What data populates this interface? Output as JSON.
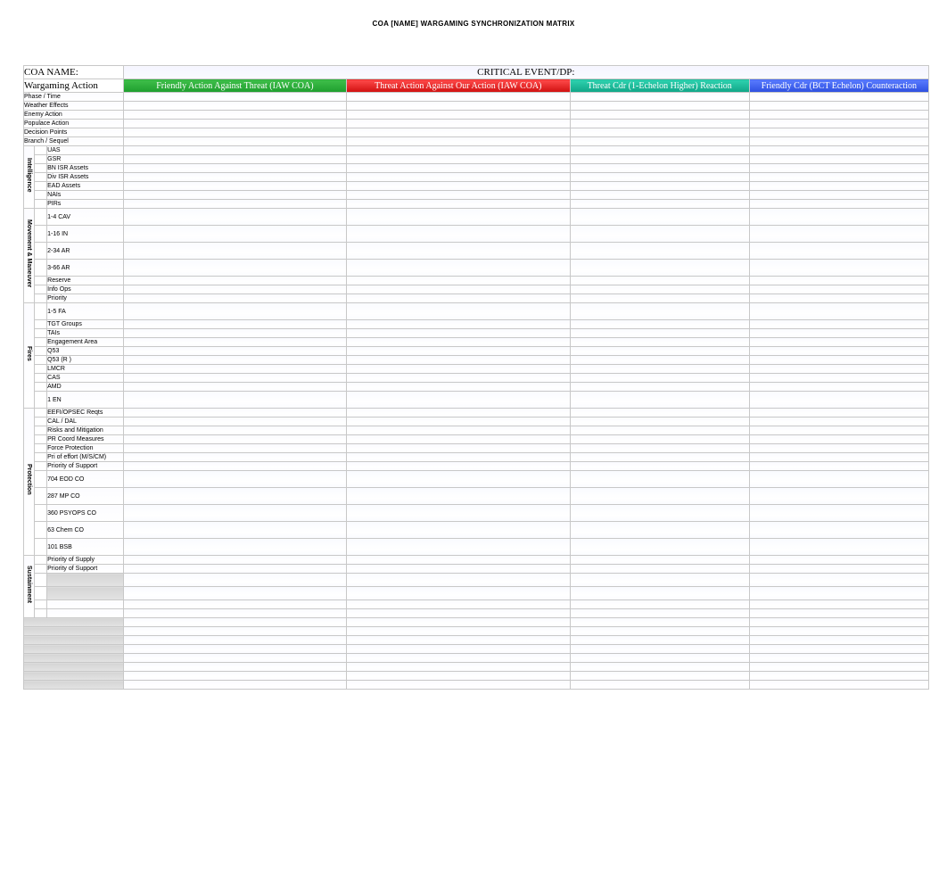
{
  "title": "COA [NAME] WARGAMING SYNCHRONIZATION MATRIX",
  "row1": {
    "coa_name_label": "COA NAME:",
    "critical_event_label": "CRITICAL EVENT/DP:"
  },
  "row2": {
    "wargaming_action": "Wargaming Action",
    "col_a": "Friendly Action Against Threat (IAW COA)",
    "col_b": "Threat Action Against Our Action (IAW COA)",
    "col_c": "Threat Cdr (1-Echelon Higher) Reaction",
    "col_d": "Friendly Cdr (BCT Echelon) Counteraction"
  },
  "top_rows": [
    "Phase / Time",
    "Weather Effects",
    "Enemy Action",
    "Populace Action",
    "Decision Points",
    "Branch / Sequel"
  ],
  "sections": {
    "intelligence": {
      "label": "Intelligence",
      "rows": [
        "UAS",
        "GSR",
        "BN ISR Assets",
        "Div ISR Assets",
        "EAD Assets",
        "NAIs",
        "PIRs"
      ]
    },
    "movement": {
      "label": "Movement & Maneuver",
      "rows": [
        "1-4 CAV",
        "1-16 IN",
        "2-34 AR",
        "3-66 AR",
        "Reserve",
        "Info Ops",
        "Priority"
      ]
    },
    "fires": {
      "label": "Fires",
      "rows": [
        "1-5 FA",
        "TGT Groups",
        "TAIs",
        "Engagement Area",
        "Q53",
        "Q53 (R )",
        "LMCR",
        "CAS",
        "AMD",
        "1 EN"
      ]
    },
    "protection": {
      "label": "Protection",
      "rows": [
        "EEFI/OPSEC Reqts",
        "CAL / DAL",
        "Risks and Mitigation",
        "PR Coord Measures",
        "Force Protection",
        "Pri of effort (M/S/CM)",
        "Priority of Support",
        "704 EOD CO",
        "287 MP CO",
        "360 PSYOPS CO",
        "63 Chem CO",
        "101 BSB"
      ]
    },
    "sustainment": {
      "label": "Sustainment",
      "rows": [
        "Priority of Supply",
        "Priority of Support"
      ]
    }
  }
}
